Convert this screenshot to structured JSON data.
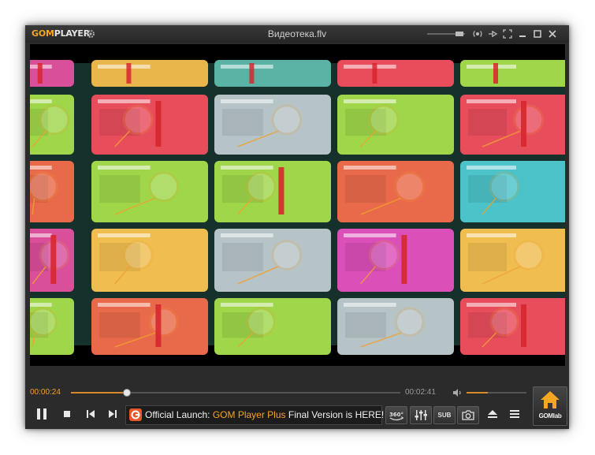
{
  "app": {
    "logo_gom": "GOM",
    "logo_player": "PLAYER",
    "title": "Видеотека.flv"
  },
  "window_controls": [
    "volume-slider",
    "surround",
    "pin",
    "fullscreen",
    "minimize",
    "maximize",
    "close"
  ],
  "playback": {
    "current_time": "00:00:24",
    "total_time": "00:02:41",
    "progress_fraction": 0.17,
    "volume_fraction": 0.35
  },
  "controls": [
    "pause",
    "stop",
    "previous",
    "next"
  ],
  "banner": {
    "prefix": "Official Launch: ",
    "highlight": "GOM Player Plus",
    "suffix": " Final Version is HERE!"
  },
  "tools": {
    "vr_label": "360°",
    "sub_label": "SUB"
  },
  "gomlab": {
    "label": "GOMlab"
  },
  "colors": {
    "accent": "#f5a623",
    "seek_fill": "#d88a2a",
    "window_bg": "#2b2b2b"
  },
  "video_frame": {
    "palette": [
      "#d94f9a",
      "#e8b64a",
      "#5bb3a6",
      "#e84d5c",
      "#9fd64a",
      "#e96a4a",
      "#f0be50",
      "#4cc3c9",
      "#b7c4c7",
      "#db4fb8"
    ]
  }
}
